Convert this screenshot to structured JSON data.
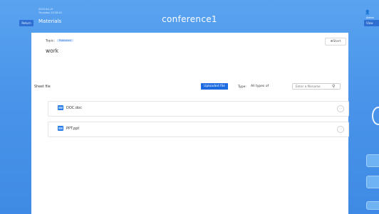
{
  "header": {
    "back_label": "Return",
    "meta_line1": "2023-04-19",
    "meta_line2": "Thursday 15:38:41",
    "section_title": "Materials",
    "conference_title": "conference1",
    "user_icon": "user-icon",
    "user_name": "Admin",
    "right_button_label": "View"
  },
  "topic": {
    "label": "Topic:",
    "badge": "Published",
    "value": "work",
    "start_label": "⊕Start"
  },
  "sheet": {
    "label": "Sheet file",
    "uploaded_button": "Uploaded file",
    "type_label": "Type:",
    "type_value": "All types of",
    "search_placeholder": "Enter a filename",
    "search_icon": "search-icon"
  },
  "files": [
    {
      "name": "DOC.doc",
      "icon": "document-file-icon"
    },
    {
      "name": "PPT.ppt",
      "icon": "presentation-file-icon"
    }
  ],
  "colors": {
    "background": "#4a94ea",
    "accent": "#1c6be0"
  }
}
